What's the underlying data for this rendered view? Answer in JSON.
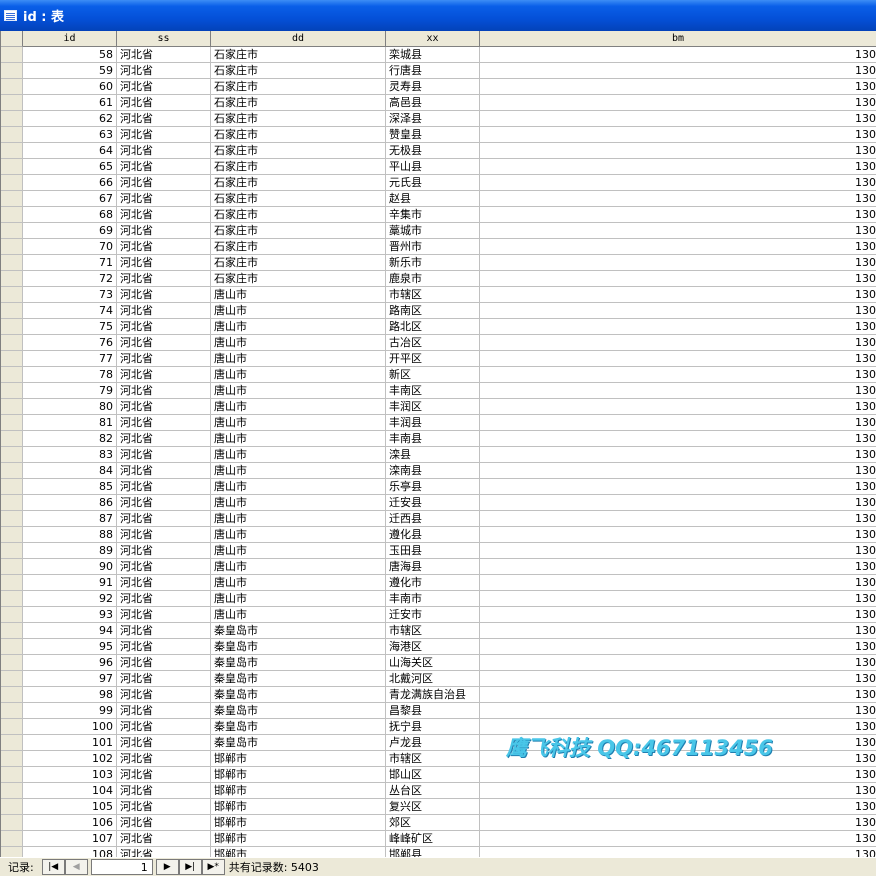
{
  "window": {
    "title": "id : 表"
  },
  "columns": [
    "id",
    "ss",
    "dd",
    "xx",
    "bm"
  ],
  "rows": [
    {
      "id": "58",
      "ss": "河北省",
      "dd": "石家庄市",
      "xx": "栾城县",
      "bm": "130"
    },
    {
      "id": "59",
      "ss": "河北省",
      "dd": "石家庄市",
      "xx": "行唐县",
      "bm": "130"
    },
    {
      "id": "60",
      "ss": "河北省",
      "dd": "石家庄市",
      "xx": "灵寿县",
      "bm": "130"
    },
    {
      "id": "61",
      "ss": "河北省",
      "dd": "石家庄市",
      "xx": "高邑县",
      "bm": "130"
    },
    {
      "id": "62",
      "ss": "河北省",
      "dd": "石家庄市",
      "xx": "深泽县",
      "bm": "130"
    },
    {
      "id": "63",
      "ss": "河北省",
      "dd": "石家庄市",
      "xx": "赞皇县",
      "bm": "130"
    },
    {
      "id": "64",
      "ss": "河北省",
      "dd": "石家庄市",
      "xx": "无极县",
      "bm": "130"
    },
    {
      "id": "65",
      "ss": "河北省",
      "dd": "石家庄市",
      "xx": "平山县",
      "bm": "130"
    },
    {
      "id": "66",
      "ss": "河北省",
      "dd": "石家庄市",
      "xx": "元氏县",
      "bm": "130"
    },
    {
      "id": "67",
      "ss": "河北省",
      "dd": "石家庄市",
      "xx": "赵县",
      "bm": "130"
    },
    {
      "id": "68",
      "ss": "河北省",
      "dd": "石家庄市",
      "xx": "辛集市",
      "bm": "130"
    },
    {
      "id": "69",
      "ss": "河北省",
      "dd": "石家庄市",
      "xx": "藁城市",
      "bm": "130"
    },
    {
      "id": "70",
      "ss": "河北省",
      "dd": "石家庄市",
      "xx": "晋州市",
      "bm": "130"
    },
    {
      "id": "71",
      "ss": "河北省",
      "dd": "石家庄市",
      "xx": "新乐市",
      "bm": "130"
    },
    {
      "id": "72",
      "ss": "河北省",
      "dd": "石家庄市",
      "xx": "鹿泉市",
      "bm": "130"
    },
    {
      "id": "73",
      "ss": "河北省",
      "dd": "唐山市",
      "xx": "市辖区",
      "bm": "130"
    },
    {
      "id": "74",
      "ss": "河北省",
      "dd": "唐山市",
      "xx": "路南区",
      "bm": "130"
    },
    {
      "id": "75",
      "ss": "河北省",
      "dd": "唐山市",
      "xx": "路北区",
      "bm": "130"
    },
    {
      "id": "76",
      "ss": "河北省",
      "dd": "唐山市",
      "xx": "古冶区",
      "bm": "130"
    },
    {
      "id": "77",
      "ss": "河北省",
      "dd": "唐山市",
      "xx": "开平区",
      "bm": "130"
    },
    {
      "id": "78",
      "ss": "河北省",
      "dd": "唐山市",
      "xx": "新区",
      "bm": "130"
    },
    {
      "id": "79",
      "ss": "河北省",
      "dd": "唐山市",
      "xx": "丰南区",
      "bm": "130"
    },
    {
      "id": "80",
      "ss": "河北省",
      "dd": "唐山市",
      "xx": "丰润区",
      "bm": "130"
    },
    {
      "id": "81",
      "ss": "河北省",
      "dd": "唐山市",
      "xx": "丰润县",
      "bm": "130"
    },
    {
      "id": "82",
      "ss": "河北省",
      "dd": "唐山市",
      "xx": "丰南县",
      "bm": "130"
    },
    {
      "id": "83",
      "ss": "河北省",
      "dd": "唐山市",
      "xx": "滦县",
      "bm": "130"
    },
    {
      "id": "84",
      "ss": "河北省",
      "dd": "唐山市",
      "xx": "滦南县",
      "bm": "130"
    },
    {
      "id": "85",
      "ss": "河北省",
      "dd": "唐山市",
      "xx": "乐亭县",
      "bm": "130"
    },
    {
      "id": "86",
      "ss": "河北省",
      "dd": "唐山市",
      "xx": "迁安县",
      "bm": "130"
    },
    {
      "id": "87",
      "ss": "河北省",
      "dd": "唐山市",
      "xx": "迁西县",
      "bm": "130"
    },
    {
      "id": "88",
      "ss": "河北省",
      "dd": "唐山市",
      "xx": "遵化县",
      "bm": "130"
    },
    {
      "id": "89",
      "ss": "河北省",
      "dd": "唐山市",
      "xx": "玉田县",
      "bm": "130"
    },
    {
      "id": "90",
      "ss": "河北省",
      "dd": "唐山市",
      "xx": "唐海县",
      "bm": "130"
    },
    {
      "id": "91",
      "ss": "河北省",
      "dd": "唐山市",
      "xx": "遵化市",
      "bm": "130"
    },
    {
      "id": "92",
      "ss": "河北省",
      "dd": "唐山市",
      "xx": "丰南市",
      "bm": "130"
    },
    {
      "id": "93",
      "ss": "河北省",
      "dd": "唐山市",
      "xx": "迁安市",
      "bm": "130"
    },
    {
      "id": "94",
      "ss": "河北省",
      "dd": "秦皇岛市",
      "xx": "市辖区",
      "bm": "130"
    },
    {
      "id": "95",
      "ss": "河北省",
      "dd": "秦皇岛市",
      "xx": "海港区",
      "bm": "130"
    },
    {
      "id": "96",
      "ss": "河北省",
      "dd": "秦皇岛市",
      "xx": "山海关区",
      "bm": "130"
    },
    {
      "id": "97",
      "ss": "河北省",
      "dd": "秦皇岛市",
      "xx": "北戴河区",
      "bm": "130"
    },
    {
      "id": "98",
      "ss": "河北省",
      "dd": "秦皇岛市",
      "xx": "青龙满族自治县",
      "bm": "130"
    },
    {
      "id": "99",
      "ss": "河北省",
      "dd": "秦皇岛市",
      "xx": "昌黎县",
      "bm": "130"
    },
    {
      "id": "100",
      "ss": "河北省",
      "dd": "秦皇岛市",
      "xx": "抚宁县",
      "bm": "130"
    },
    {
      "id": "101",
      "ss": "河北省",
      "dd": "秦皇岛市",
      "xx": "卢龙县",
      "bm": "130"
    },
    {
      "id": "102",
      "ss": "河北省",
      "dd": "邯郸市",
      "xx": "市辖区",
      "bm": "130"
    },
    {
      "id": "103",
      "ss": "河北省",
      "dd": "邯郸市",
      "xx": "邯山区",
      "bm": "130"
    },
    {
      "id": "104",
      "ss": "河北省",
      "dd": "邯郸市",
      "xx": "丛台区",
      "bm": "130"
    },
    {
      "id": "105",
      "ss": "河北省",
      "dd": "邯郸市",
      "xx": "复兴区",
      "bm": "130"
    },
    {
      "id": "106",
      "ss": "河北省",
      "dd": "邯郸市",
      "xx": "郊区",
      "bm": "130"
    },
    {
      "id": "107",
      "ss": "河北省",
      "dd": "邯郸市",
      "xx": "峰峰矿区",
      "bm": "130"
    },
    {
      "id": "108",
      "ss": "河北省",
      "dd": "邯郸市",
      "xx": "邯郸县",
      "bm": "130"
    }
  ],
  "watermark": "鹰飞科技 QQ:467113456",
  "navigation": {
    "label": "记录:",
    "first_icon": "first-record-icon",
    "prev_icon": "previous-record-icon",
    "next_icon": "next-record-icon",
    "last_icon": "last-record-icon",
    "new_icon": "new-record-icon",
    "current_record": "1",
    "total_text": "共有记录数: 5403"
  }
}
